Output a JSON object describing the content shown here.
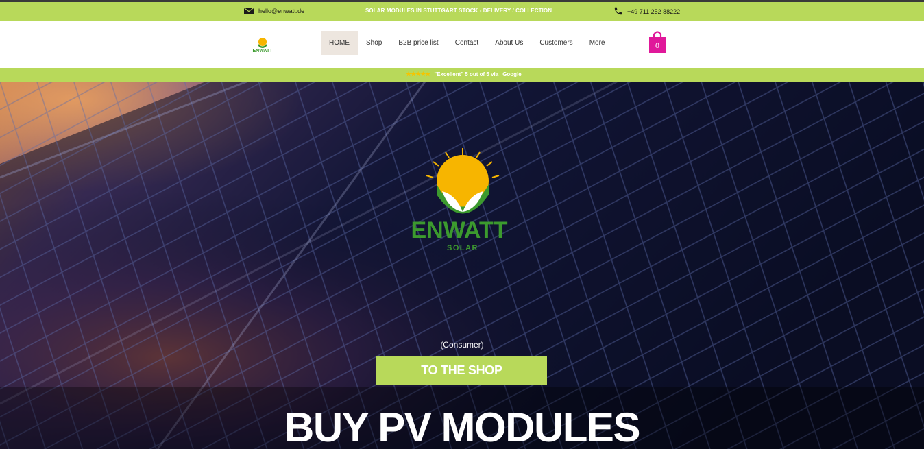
{
  "topbar": {
    "email": "hello@enwatt.de",
    "promo": "SOLAR MODULES IN STUTTGART STOCK - DELIVERY / COLLECTION",
    "phone": "+49 711 252 88222"
  },
  "header": {
    "nav": [
      "HOME",
      "Shop",
      "B2B price list",
      "Contact",
      "About Us",
      "Customers",
      "More"
    ],
    "cart_count": "0"
  },
  "rating": {
    "stars": "★★★★★",
    "text": "\"Excellent\" 5 out of 5 via",
    "source": "Google"
  },
  "hero": {
    "logo_name": "ENWATT",
    "logo_sub": "SOLAR",
    "consumer": "(Consumer)",
    "cta": "TO THE SHOP",
    "headline": "BUY PV MODULES"
  },
  "colors": {
    "accent_green": "#b8d95a",
    "cart_pink": "#e0189a",
    "sun_yellow": "#f7b500",
    "leaf_green": "#3c9a2e"
  },
  "icons": [
    "envelope-icon",
    "phone-icon",
    "shopping-bag-icon",
    "enwatt-logo"
  ]
}
